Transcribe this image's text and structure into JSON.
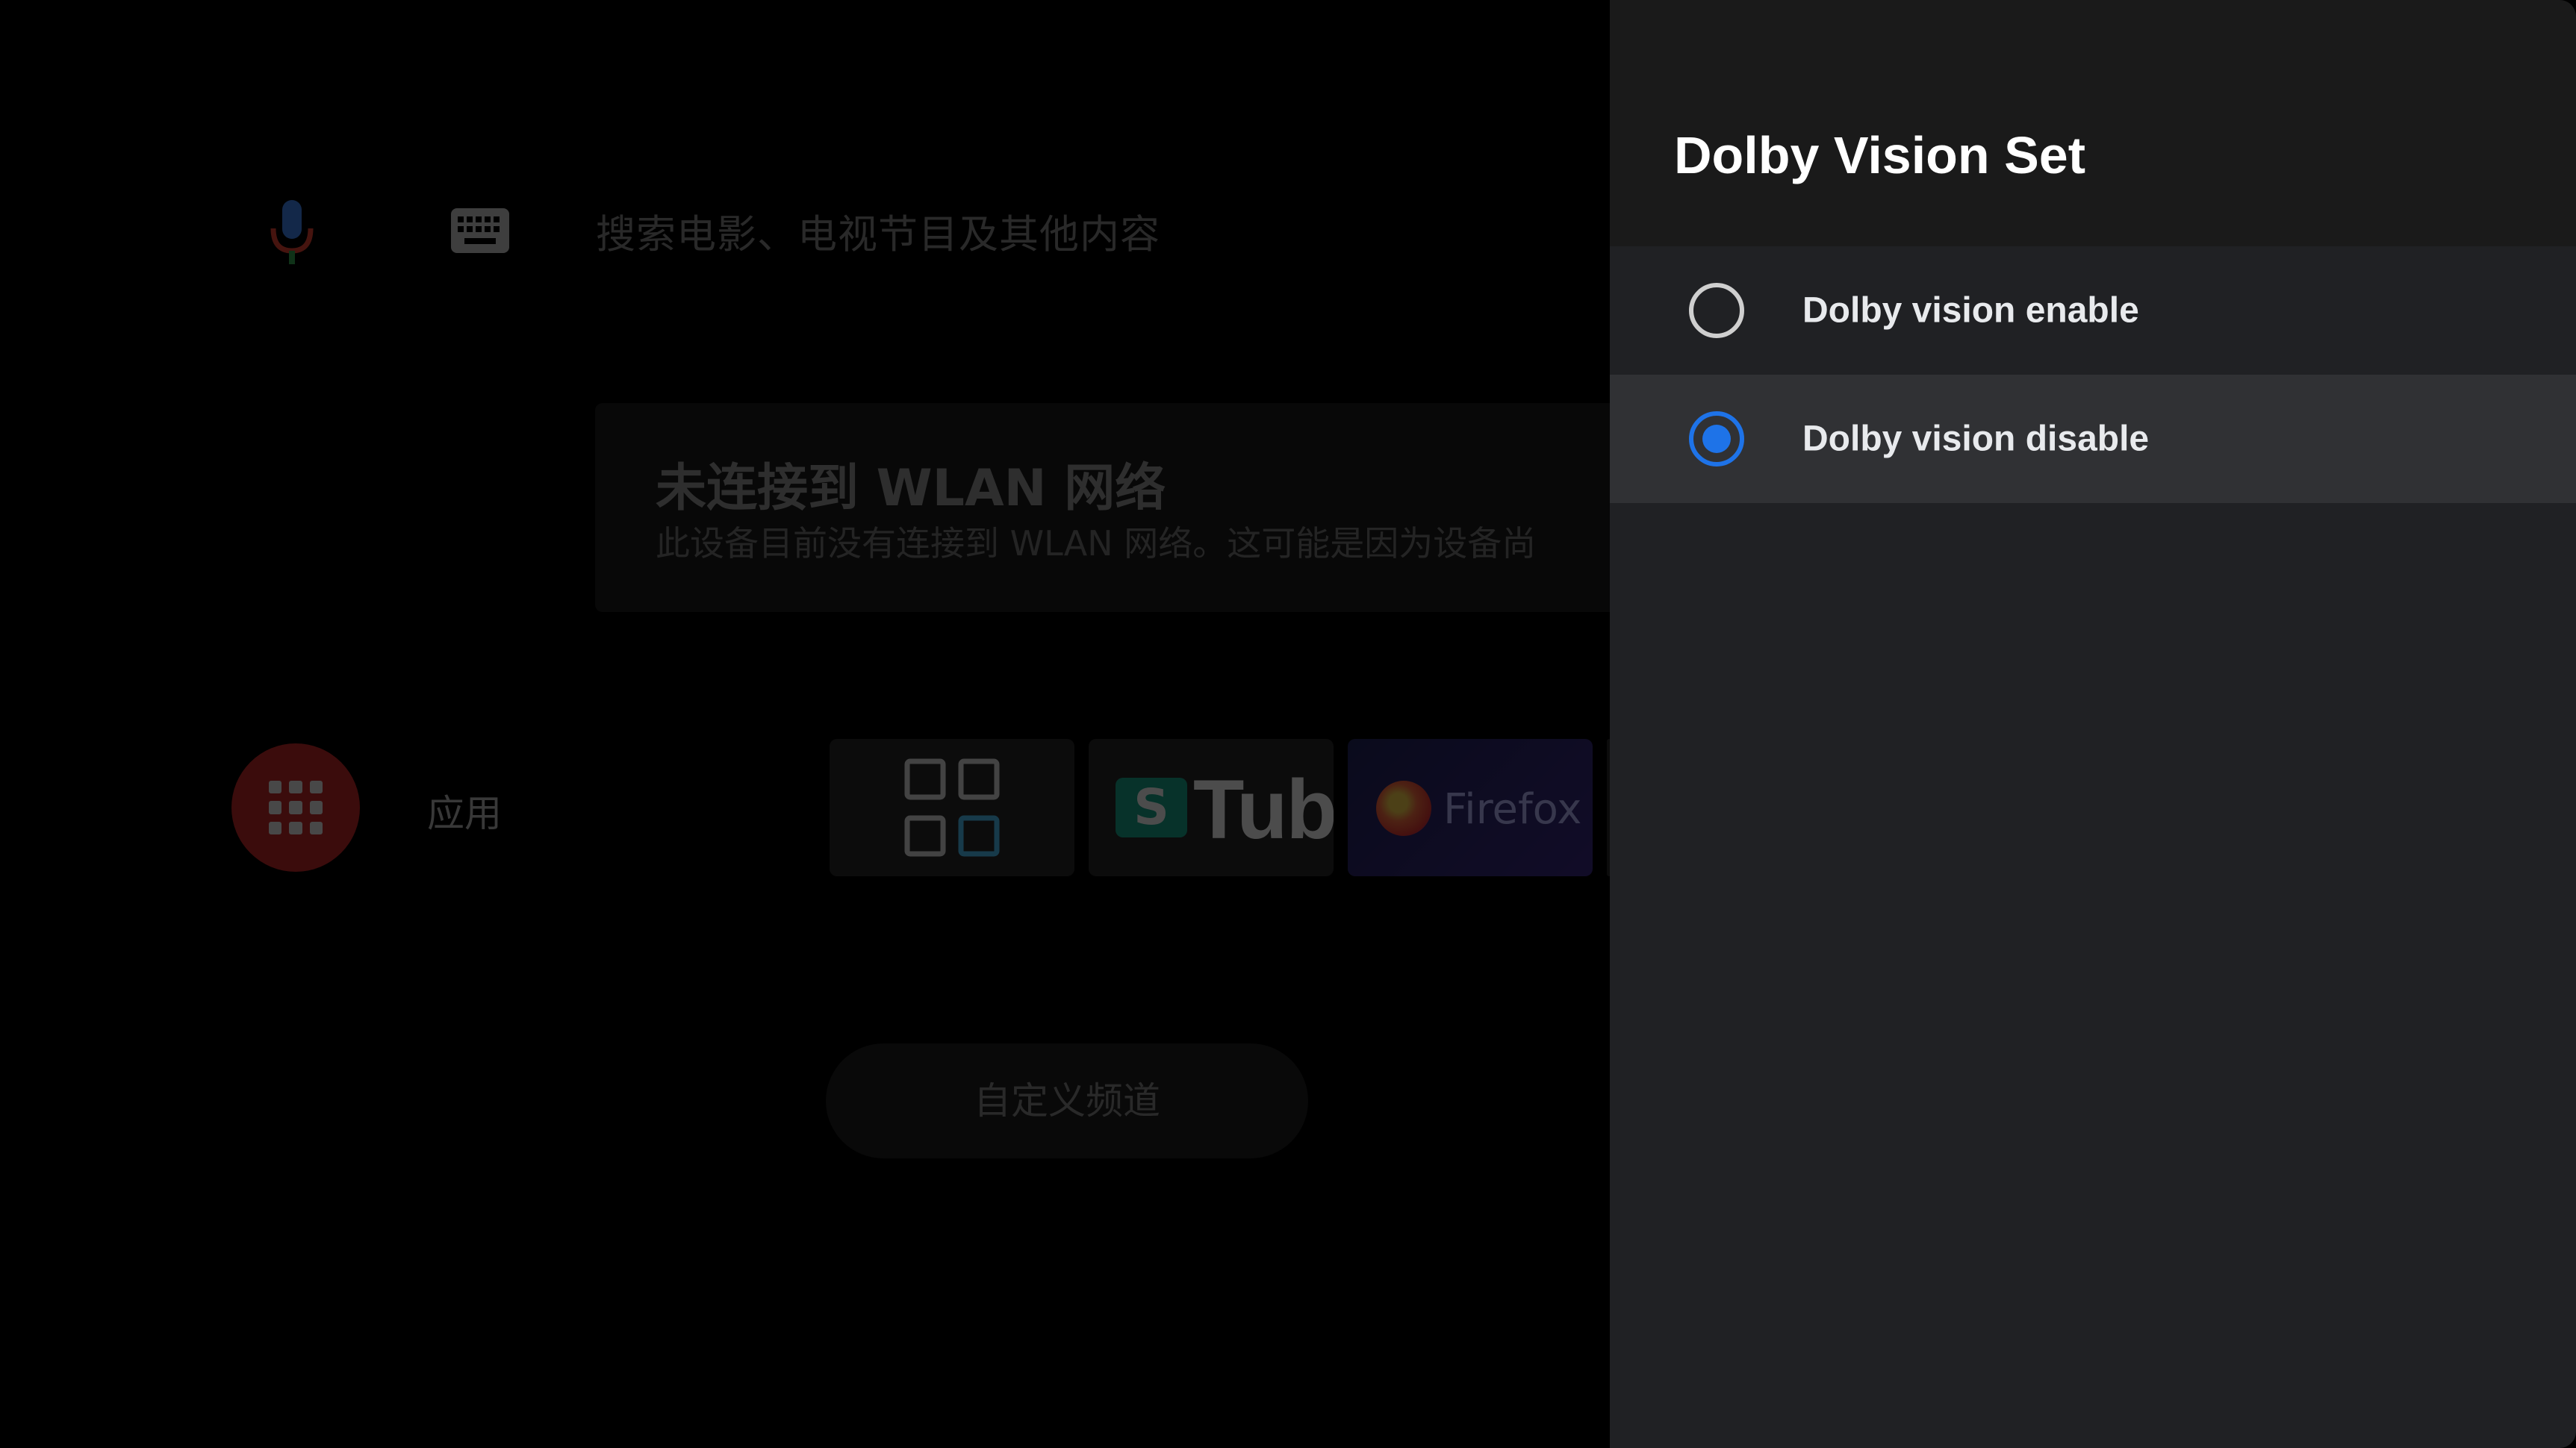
{
  "launcher": {
    "search_hint": "搜索电影、电视节目及其他内容",
    "wifi_notice": {
      "title": "未连接到 WLAN 网络",
      "description": "此设备目前没有连接到 WLAN 网络。这可能是因为设备尚"
    },
    "apps_label": "应用",
    "app_tiles": [
      {
        "name": "app-grid",
        "text": ""
      },
      {
        "name": "youtube",
        "badge": "S",
        "text": "Tube"
      },
      {
        "name": "firefox",
        "text": "Firefox"
      }
    ],
    "custom_channel_label": "自定义频道"
  },
  "panel": {
    "title": "Dolby Vision Set",
    "options": [
      {
        "label": "Dolby vision enable",
        "checked": false
      },
      {
        "label": "Dolby vision disable",
        "checked": true
      }
    ]
  },
  "colors": {
    "panel_bg": "#202124",
    "panel_header_bg": "#1a1a1a",
    "selected_row_bg": "#303134",
    "accent": "#1e73e8",
    "apps_button": "#c62828"
  },
  "icons": [
    "mic-icon",
    "keyboard-icon",
    "apps-grid-icon",
    "radio-button-icon"
  ]
}
